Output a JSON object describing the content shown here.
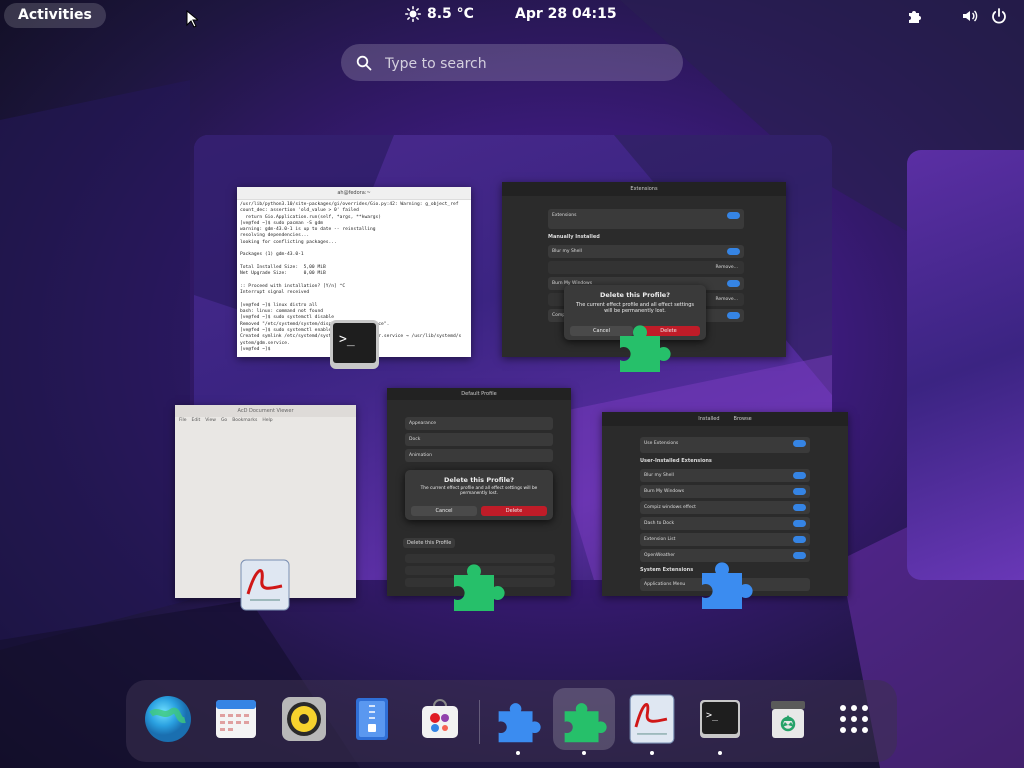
{
  "topbar": {
    "activities_label": "Activities",
    "weather": {
      "icon": "sun-icon",
      "temperature": "8.5 °C"
    },
    "clock": "Apr 28  04:15",
    "tray_icons": [
      "extensions-icon",
      "volume-icon",
      "power-icon"
    ]
  },
  "search": {
    "placeholder": "Type to search"
  },
  "windows": {
    "terminal": {
      "title": "ah@fedora:~",
      "lines": [
        "/usr/lib/python3.10/site-packages/gi/overrides/Gio.py:42: Warning: g_object_ref",
        "count_dec: assertion 'old_value > 0' failed",
        "  return Gio.Application.run(self, *args, **kwargs)",
        "[ve@fed ~]$ sudo pacman -S gdm",
        "warning: gdm-43.0-1 is up to date -- reinstalling",
        "resolving dependencies...",
        "looking for conflicting packages...",
        "",
        "Packages (1) gdm-43.0-1",
        "",
        "Total Installed Size:  5,00 MiB",
        "Net Upgrade Size:      0,00 MiB",
        "",
        ":: Proceed with installation? [Y/n] ^C",
        "Interrupt signal received",
        "",
        "[ve@fed ~]$ linux distro all",
        "bash: linux: command not found",
        "[ve@fed ~]$ sudo systemctl disable",
        "Removed \"/etc/systemd/system/display-manager.service\".",
        "[ve@fed ~]$ sudo systemctl enable",
        "Created symlink /etc/systemd/system/display-manager.service → /usr/lib/systemd/s",
        "ystem/gdm.service.",
        "[ve@fed ~]$ "
      ]
    },
    "extensions_a": {
      "title": "Extensions",
      "rows": [
        "Extensions",
        "Manually Installed",
        "Blur my Shell",
        "Burn My Windows",
        "Compiz windows effect"
      ],
      "remove_label": "Remove...",
      "dialog": {
        "title": "Delete this Profile?",
        "body": "The current effect profile and all effect settings will be permanently lost.",
        "cancel": "Cancel",
        "delete": "Delete"
      }
    },
    "extensions_b": {
      "title": "Default Profile",
      "fields": [
        "Appearance",
        "Dock",
        "Animation"
      ],
      "dialog": {
        "title": "Delete this Profile?",
        "body": "The current effect profile and all effect settings will be permanently lost.",
        "cancel": "Cancel",
        "delete": "Delete"
      },
      "footer": "Delete this Profile"
    },
    "extensions_c": {
      "tabs": [
        "Installed",
        "Browse"
      ],
      "use_extensions": "Use Extensions",
      "section_user": "User-Installed Extensions",
      "items": [
        "Blur my Shell",
        "Burn My Windows",
        "Compiz windows effect",
        "Dash to Dock",
        "Extension List",
        "OpenWeather"
      ],
      "section_system": "System Extensions",
      "system_items": [
        "Applications Menu"
      ]
    },
    "document": {
      "title": "AcD Document Viewer",
      "menu": [
        "File",
        "Edit",
        "View",
        "Go",
        "Bookmarks",
        "Help"
      ]
    }
  },
  "dock": {
    "items": [
      {
        "name": "browser-icon",
        "running": false
      },
      {
        "name": "calendar-icon",
        "running": false
      },
      {
        "name": "music-player-icon",
        "running": false
      },
      {
        "name": "file-archive-icon",
        "running": false
      },
      {
        "name": "software-store-icon",
        "running": false
      },
      {
        "name": "extensions-app-icon",
        "running": true
      },
      {
        "name": "extension-manager-icon",
        "running": true,
        "active": true
      },
      {
        "name": "document-viewer-icon",
        "running": true
      },
      {
        "name": "terminal-icon",
        "running": true
      },
      {
        "name": "trash-icon",
        "running": false
      },
      {
        "name": "app-grid-icon",
        "running": false
      }
    ]
  },
  "colors": {
    "accent_blue": "#3584e4",
    "puzzle_green": "#26c06a",
    "puzzle_blue": "#3b8cf0"
  }
}
